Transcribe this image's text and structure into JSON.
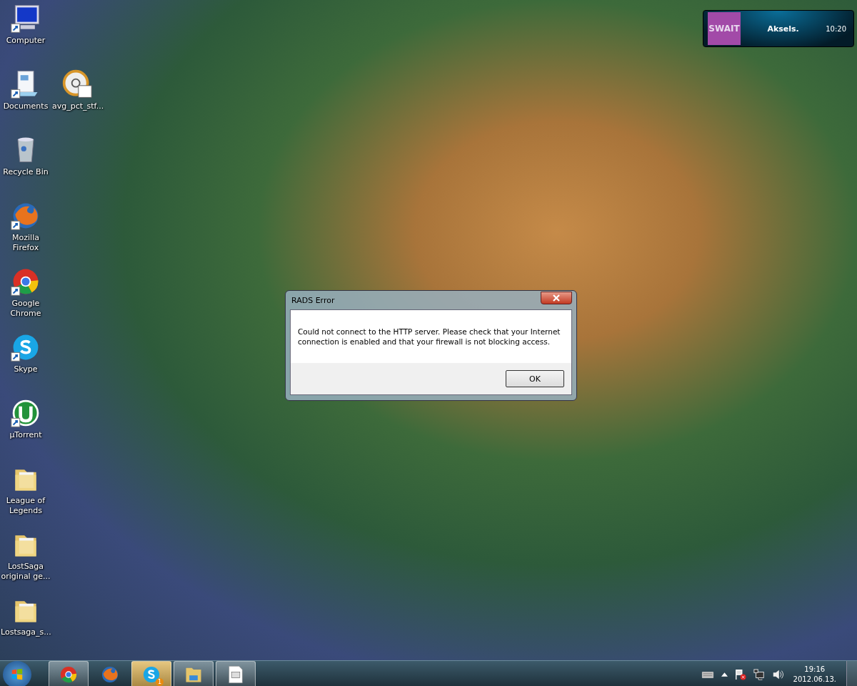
{
  "desktop_rows": [
    [
      {
        "label": "Computer",
        "kind": "computer",
        "shortcut": true
      }
    ],
    [
      {
        "label": "Documents",
        "kind": "documents",
        "shortcut": true
      },
      {
        "label": "avg_pct_stf...",
        "kind": "gauge",
        "shortcut": false
      }
    ],
    [
      {
        "label": "Recycle Bin",
        "kind": "recycle-bin",
        "shortcut": false
      }
    ],
    [
      {
        "label": "Mozilla Firefox",
        "kind": "firefox",
        "shortcut": true
      }
    ],
    [
      {
        "label": "Google Chrome",
        "kind": "chrome",
        "shortcut": true
      }
    ],
    [
      {
        "label": "Skype",
        "kind": "skype",
        "shortcut": true
      }
    ],
    [
      {
        "label": "µTorrent",
        "kind": "torrent",
        "shortcut": true
      }
    ],
    [
      {
        "label": "League of Legends",
        "kind": "folder",
        "shortcut": false
      }
    ],
    [
      {
        "label": "LostSaga original ge...",
        "kind": "folder",
        "shortcut": false
      }
    ],
    [
      {
        "label": "Lostsaga_s...",
        "kind": "folder",
        "shortcut": false
      }
    ]
  ],
  "widget": {
    "logo": "SWAIT",
    "name": "Aksels.",
    "time": "10:20"
  },
  "dialog": {
    "title": "RADS Error",
    "message": "Could not connect to the HTTP server.  Please check that your Internet connection is enabled and that your firewall is not blocking access.",
    "button": "OK"
  },
  "taskbar": {
    "items": [
      {
        "kind": "chrome",
        "running": true,
        "attention": false
      },
      {
        "kind": "firefox",
        "running": false,
        "attention": false
      },
      {
        "kind": "skype",
        "running": true,
        "attention": true,
        "badge": "1"
      },
      {
        "kind": "explorer",
        "running": true,
        "attention": false
      },
      {
        "kind": "document",
        "running": true,
        "attention": false
      }
    ],
    "clock": {
      "time": "19:16",
      "date": "2012.06.13."
    }
  }
}
